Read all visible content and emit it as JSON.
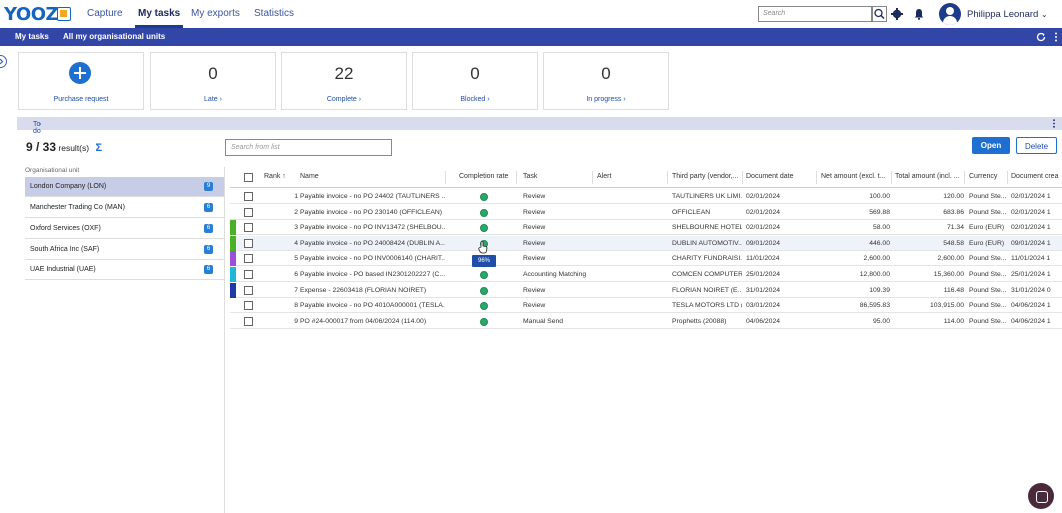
{
  "app": {
    "logo": "YOOZ"
  },
  "nav": {
    "tabs": [
      {
        "label": "Capture"
      },
      {
        "label": "My tasks",
        "active": true
      },
      {
        "label": "My exports"
      },
      {
        "label": "Statistics"
      }
    ]
  },
  "search": {
    "placeholder": "Search"
  },
  "user": {
    "name": "Philippa Leonard"
  },
  "subnav": {
    "items": [
      "My tasks",
      "All my organisational units"
    ]
  },
  "cards": [
    {
      "label": "Purchase request",
      "icon": "plus-circle-icon"
    },
    {
      "value": "0",
      "label": "Late"
    },
    {
      "value": "22",
      "label": "Complete"
    },
    {
      "value": "0",
      "label": "Blocked"
    },
    {
      "value": "0",
      "label": "In progress"
    }
  ],
  "todo": {
    "label": "To do"
  },
  "results": {
    "count": "9 / 33",
    "suffix": " result(s)"
  },
  "filter": {
    "placeholder": "Search from list"
  },
  "actions": {
    "open": "Open",
    "delete": "Delete"
  },
  "org": {
    "label": "Organisational unit",
    "items": [
      {
        "name": "London Company (LON)",
        "count": "9",
        "selected": true
      },
      {
        "name": "Manchester Trading Co (MAN)",
        "count": "6"
      },
      {
        "name": "Oxford Services (OXF)",
        "count": "6"
      },
      {
        "name": "South Africa Inc (SAF)",
        "count": "6"
      },
      {
        "name": "UAE Industrial (UAE)",
        "count": "6"
      }
    ]
  },
  "table": {
    "columns": [
      "Rank",
      "Name",
      "Completion rate",
      "Task",
      "Alert",
      "Third party (vendor,...",
      "Document date",
      "Net amount (excl. t...",
      "Total amount (incl. ...",
      "Currency",
      "Document crea"
    ],
    "rows": [
      {
        "rank": "1",
        "name": "Payable invoice - no PO 24402 (TAUTLINERS ...",
        "task": "Review",
        "third": "TAUTLINERS UK LIMI...",
        "date": "02/01/2024",
        "net": "100.00",
        "total": "120.00",
        "cur": "Pound Ste...",
        "created": "02/01/2024 1",
        "color": ""
      },
      {
        "rank": "2",
        "name": "Payable invoice - no PO 230140 (OFFICLEAN)",
        "task": "Review",
        "third": "OFFICLEAN",
        "date": "02/01/2024",
        "net": "569.88",
        "total": "683.86",
        "cur": "Pound Ste...",
        "created": "02/01/2024 1",
        "color": ""
      },
      {
        "rank": "3",
        "name": "Payable invoice - no PO INV13472 (SHELBOU...",
        "task": "Review",
        "third": "SHELBOURNE HOTEL...",
        "date": "02/01/2024",
        "net": "58.00",
        "total": "71.34",
        "cur": "Euro (EUR)",
        "created": "02/01/2024 1",
        "color": "#4caf2a"
      },
      {
        "rank": "4",
        "name": "Payable invoice - no PO 24008424 (DUBLIN A...",
        "task": "Review",
        "third": "DUBLIN AUTOMOTIV...",
        "date": "09/01/2024",
        "net": "446.00",
        "total": "548.58",
        "cur": "Euro (EUR)",
        "created": "09/01/2024 1",
        "color": "#4caf2a",
        "hover": true
      },
      {
        "rank": "5",
        "name": "Payable invoice - no PO INV0006140 (CHARIT...",
        "task": "Review",
        "third": "CHARITY FUNDRAISI...",
        "date": "11/01/2024",
        "net": "2,600.00",
        "total": "2,600.00",
        "cur": "Pound Ste...",
        "created": "11/01/2024 1",
        "color": "#9c4fd8"
      },
      {
        "rank": "6",
        "name": "Payable invoice - PO based IN2301202227 (C...",
        "task": "Accounting Matching",
        "third": "COMCEN COMPUTER...",
        "date": "25/01/2024",
        "net": "12,800.00",
        "total": "15,360.00",
        "cur": "Pound Ste...",
        "created": "25/01/2024 1",
        "color": "#1fb8d8"
      },
      {
        "rank": "7",
        "name": "Expense - 22603418 (FLORIAN NOIRET)",
        "task": "Review",
        "third": "FLORIAN NOIRET (E...",
        "date": "31/01/2024",
        "net": "109.39",
        "total": "116.48",
        "cur": "Pound Ste...",
        "created": "31/01/2024 0",
        "color": "#1e3aa8"
      },
      {
        "rank": "8",
        "name": "Payable invoice - no PO 4010A000001 (TESLA...",
        "task": "Review",
        "third": "TESLA MOTORS LTD (...",
        "date": "03/01/2024",
        "net": "86,595.83",
        "total": "103,915.00",
        "cur": "Pound Ste...",
        "created": "04/06/2024 1",
        "color": ""
      },
      {
        "rank": "9",
        "name": "PO #24-000017 from 04/06/2024 (114.00)",
        "task": "Manual Send",
        "third": "Prophetts (20088)",
        "date": "04/06/2024",
        "net": "95.00",
        "total": "114.00",
        "cur": "Pound Ste...",
        "created": "04/06/2024 1",
        "color": ""
      }
    ],
    "tooltip": "96%"
  }
}
